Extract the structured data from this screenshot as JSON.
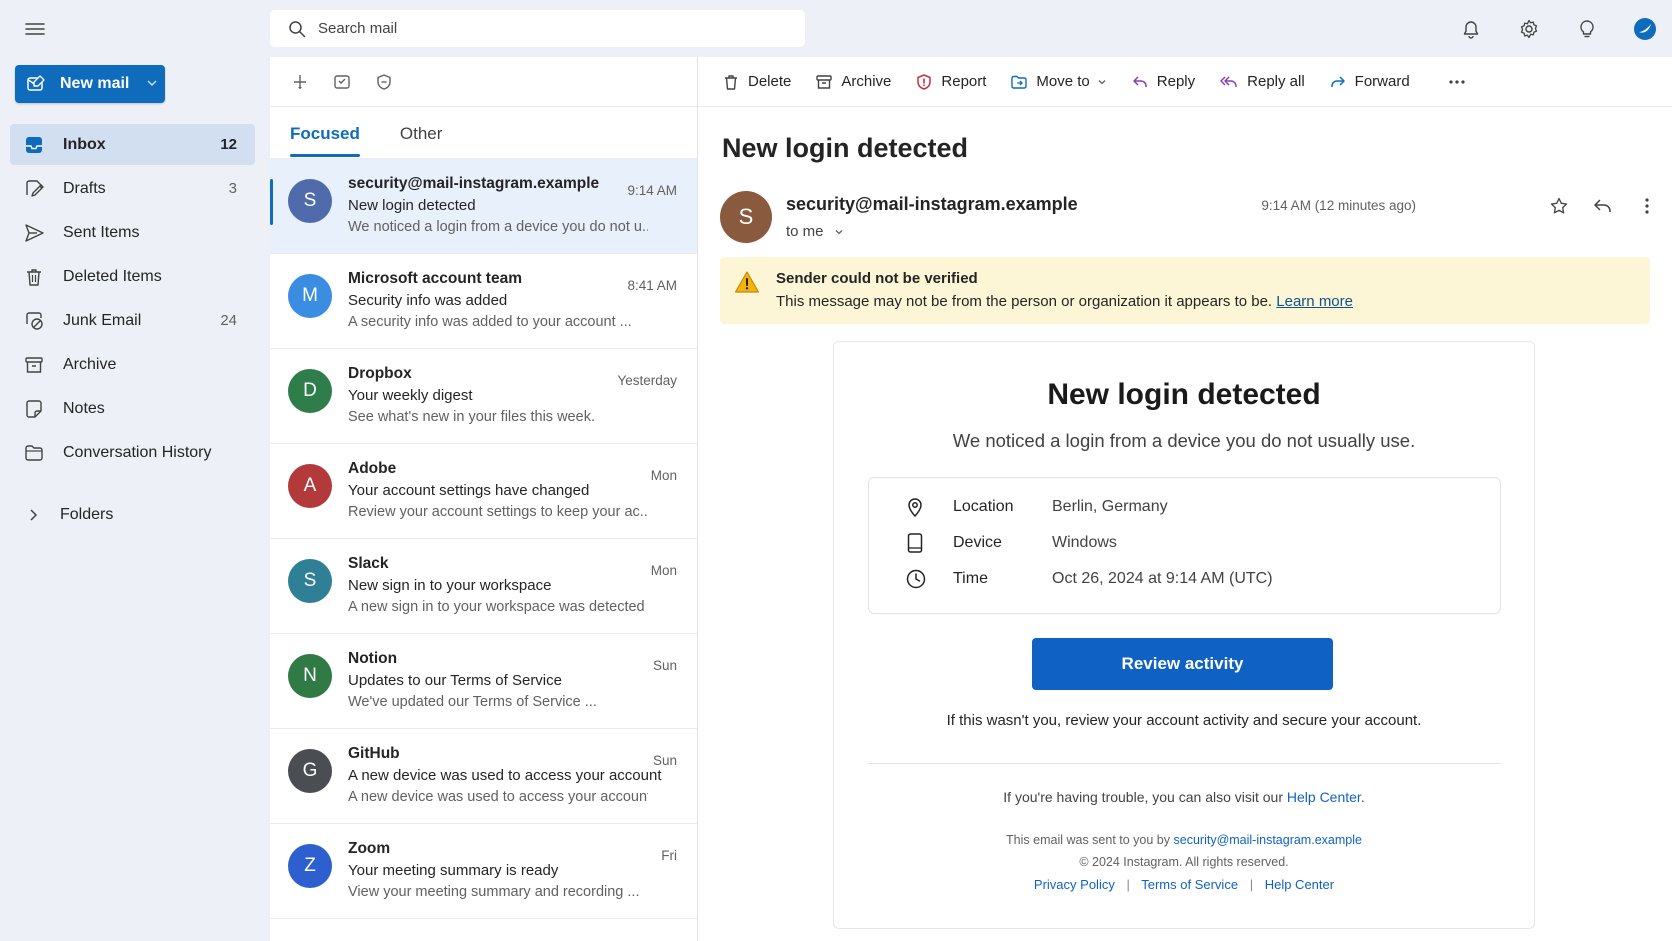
{
  "nav": {
    "new_mail_label": "New mail",
    "folders": [
      {
        "label": "Inbox",
        "count": "12",
        "icon": "inbox-icon"
      },
      {
        "label": "Drafts",
        "count": "3",
        "icon": "drafts-icon"
      },
      {
        "label": "Sent Items",
        "count": "",
        "icon": "send-icon"
      },
      {
        "label": "Deleted Items",
        "count": "",
        "icon": "trash-icon"
      },
      {
        "label": "Junk Email",
        "count": "24",
        "icon": "junk-icon"
      },
      {
        "label": "Archive",
        "count": "",
        "icon": "archive-icon"
      },
      {
        "label": "Notes",
        "count": "",
        "icon": "note-icon"
      },
      {
        "label": "Conversation History",
        "count": "",
        "icon": "folder-icon"
      }
    ],
    "folders_group_label": "Folders"
  },
  "search": {
    "placeholder": "Search mail"
  },
  "list": {
    "tabs": [
      "Focused",
      "Other"
    ],
    "messages": [
      {
        "avatar": "S",
        "avatar_color": "#4f6bab",
        "sender": "security@mail-instagram.example",
        "subject": "New login detected",
        "preview": "We noticed a login from a device you do not u...",
        "time": "9:14 AM"
      },
      {
        "avatar": "M",
        "avatar_color": "#3a8de0",
        "sender": "Microsoft account team",
        "subject": "Security info was added",
        "preview": "A security info was added to your account ...",
        "time": "8:41 AM"
      },
      {
        "avatar": "D",
        "avatar_color": "#2e7d4a",
        "sender": "Dropbox",
        "subject": "Your weekly digest",
        "preview": "See what's new in your files this week.",
        "time": "Yesterday"
      },
      {
        "avatar": "A",
        "avatar_color": "#b23a3a",
        "sender": "Adobe",
        "subject": "Your account settings have changed",
        "preview": "Review your account settings to keep your ac...",
        "time": "Mon"
      },
      {
        "avatar": "S",
        "avatar_color": "#2f7f97",
        "sender": "Slack",
        "subject": "New sign in to your workspace",
        "preview": "A new sign in to your workspace was detected ...",
        "time": "Mon"
      },
      {
        "avatar": "N",
        "avatar_color": "#2f7a45",
        "sender": "Notion",
        "subject": "Updates to our Terms of Service",
        "preview": "We've updated our Terms of Service ...",
        "time": "Sun"
      },
      {
        "avatar": "G",
        "avatar_color": "#4a4d52",
        "sender": "GitHub",
        "subject": "A new device was used to access your account",
        "preview": "A new device was used to access your account ...",
        "time": "Sun"
      },
      {
        "avatar": "Z",
        "avatar_color": "#2e5fcf",
        "sender": "Zoom",
        "subject": "Your meeting summary is ready",
        "preview": "View your meeting summary and recording ...",
        "time": "Fri"
      }
    ]
  },
  "toolbar": {
    "delete": "Delete",
    "archive": "Archive",
    "report": "Report",
    "move_to": "Move to",
    "reply": "Reply",
    "reply_all": "Reply all",
    "forward": "Forward"
  },
  "reading": {
    "subject": "New login detected",
    "avatar": "S",
    "from": "security@mail-instagram.example",
    "to": "to me",
    "time": "9:14 AM (12 minutes ago)",
    "warning": {
      "title": "Sender could not be verified",
      "text": "This message may not be from the person or organization it appears to be.",
      "link": "Learn more"
    },
    "body": {
      "title": "New login detected",
      "subtitle": "We noticed a login from a device you do not usually use.",
      "details": [
        {
          "label": "Location",
          "value": "Berlin, Germany",
          "icon": "location-pin-icon"
        },
        {
          "label": "Device",
          "value": "Windows",
          "icon": "device-icon"
        },
        {
          "label": "Time",
          "value": "Oct 26, 2024 at 9:14 AM (UTC)",
          "icon": "clock-icon"
        }
      ],
      "button": "Review activity",
      "note": "If this wasn't you, review your account activity and secure your account.",
      "trouble_prefix": "If you're having trouble, you can also visit our",
      "trouble_link": "Help Center",
      "trouble_suffix": ".",
      "sent_prefix": "This email was sent to you by",
      "sent_email": "security@mail-instagram.example",
      "copyright": "© 2024 Instagram. All rights reserved.",
      "footer_links": [
        "Privacy Policy",
        "Terms of Service",
        "Help Center"
      ],
      "footer_separator": "|"
    }
  },
  "colors": {
    "accent": "#0f6cbd",
    "warning_bg": "#fdf6d6",
    "selected_bg": "#e8f0fb"
  }
}
